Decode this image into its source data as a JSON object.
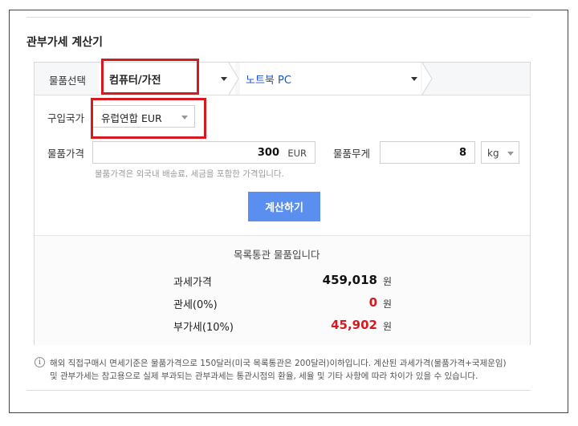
{
  "header": {
    "title": "관부가세 계산기"
  },
  "category": {
    "label": "물품선택",
    "main_selected": "컴퓨터/가전",
    "sub_selected": "노트북 PC"
  },
  "form": {
    "country_label": "구입국가",
    "country_selected": "유럽연합 EUR",
    "price_label": "물품가격",
    "price_value": "300",
    "price_unit": "EUR",
    "weight_label": "물품무게",
    "weight_value": "8",
    "weight_unit": "kg",
    "price_hint": "물품가격은 외국내 배송료, 세금을 포함한 가격입니다.",
    "calc_button": "계산하기"
  },
  "results": {
    "message": "목록통관 물품입니다",
    "rows": [
      {
        "label": "과세가격",
        "value": "459,018",
        "unit": "원"
      },
      {
        "label": "관세(0%)",
        "value": "0",
        "unit": "원"
      },
      {
        "label": "부가세(10%)",
        "value": "45,902",
        "unit": "원"
      }
    ]
  },
  "notice": {
    "line1": "해외 직접구매시 면세기준은 물품가격으로 150달러(미국 목록통관은 200달러)이하입니다. 계산된 과세가격(물품가격+국제운임)",
    "line2": "및 관부가세는 참고용으로 실제 부과되는 관부과세는 통관시점의 환율, 세율 및 기타 사항에 따라 차이가 있을 수 있습니다."
  },
  "colors": {
    "accent_blue": "#5a8ff0",
    "highlight_red": "#d71920",
    "value_red": "#d71920"
  }
}
